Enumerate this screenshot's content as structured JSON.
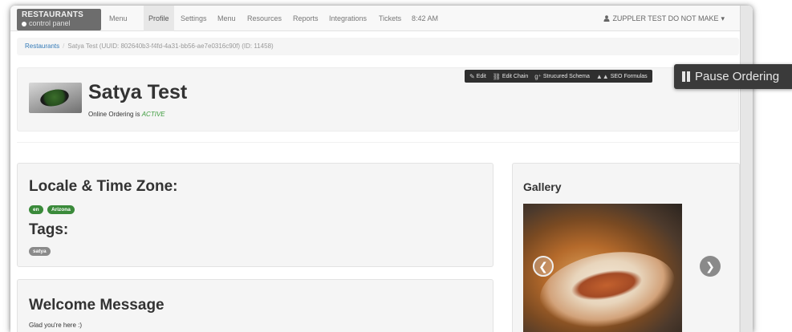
{
  "navbar": {
    "brand_title": "RESTAURANTS",
    "brand_subtitle": "control panel",
    "items": [
      "Menu",
      "Profile",
      "Settings",
      "Menu",
      "Resources",
      "Reports",
      "Integrations",
      "Tickets"
    ],
    "active_item": "Profile",
    "time": "8:42 AM",
    "user": "ZUPPLER TEST DO NOT MAKE",
    "user_icon": "user-icon",
    "caret_icon": "caret-down-icon"
  },
  "breadcrumb": {
    "root": "Restaurants",
    "current": "Satya Test (UUID: 802640b3-f4fd-4a31-bb56-ae7e0316c90f) (ID: 11458)"
  },
  "header": {
    "name": "Satya Test",
    "ordering_label": "Online Ordering is",
    "ordering_status": "ACTIVE",
    "actions": [
      {
        "label": "Edit",
        "icon": "edit-icon"
      },
      {
        "label": "Edit Chain",
        "icon": "link-icon"
      },
      {
        "label": "Strucured Schema",
        "icon": "google-plus-icon"
      },
      {
        "label": "SEO Formulas",
        "icon": "binoculars-icon"
      }
    ],
    "pause_label": "Pause Ordering"
  },
  "locale": {
    "title": "Locale & Time Zone:",
    "language": "en",
    "timezone": "Arizona",
    "tags_title": "Tags:",
    "tags": [
      "satya"
    ]
  },
  "welcome": {
    "title": "Welcome Message",
    "text": "Glad you're here :)"
  },
  "gallery": {
    "title": "Gallery",
    "prev_glyph": "❮",
    "next_glyph": "❯"
  },
  "colors": {
    "status_active": "#3c9b3c",
    "link": "#337ab7",
    "badge_green": "#3a8a3a",
    "badge_gray": "#8a8a8a",
    "dark_button": "#3a3a3a"
  }
}
